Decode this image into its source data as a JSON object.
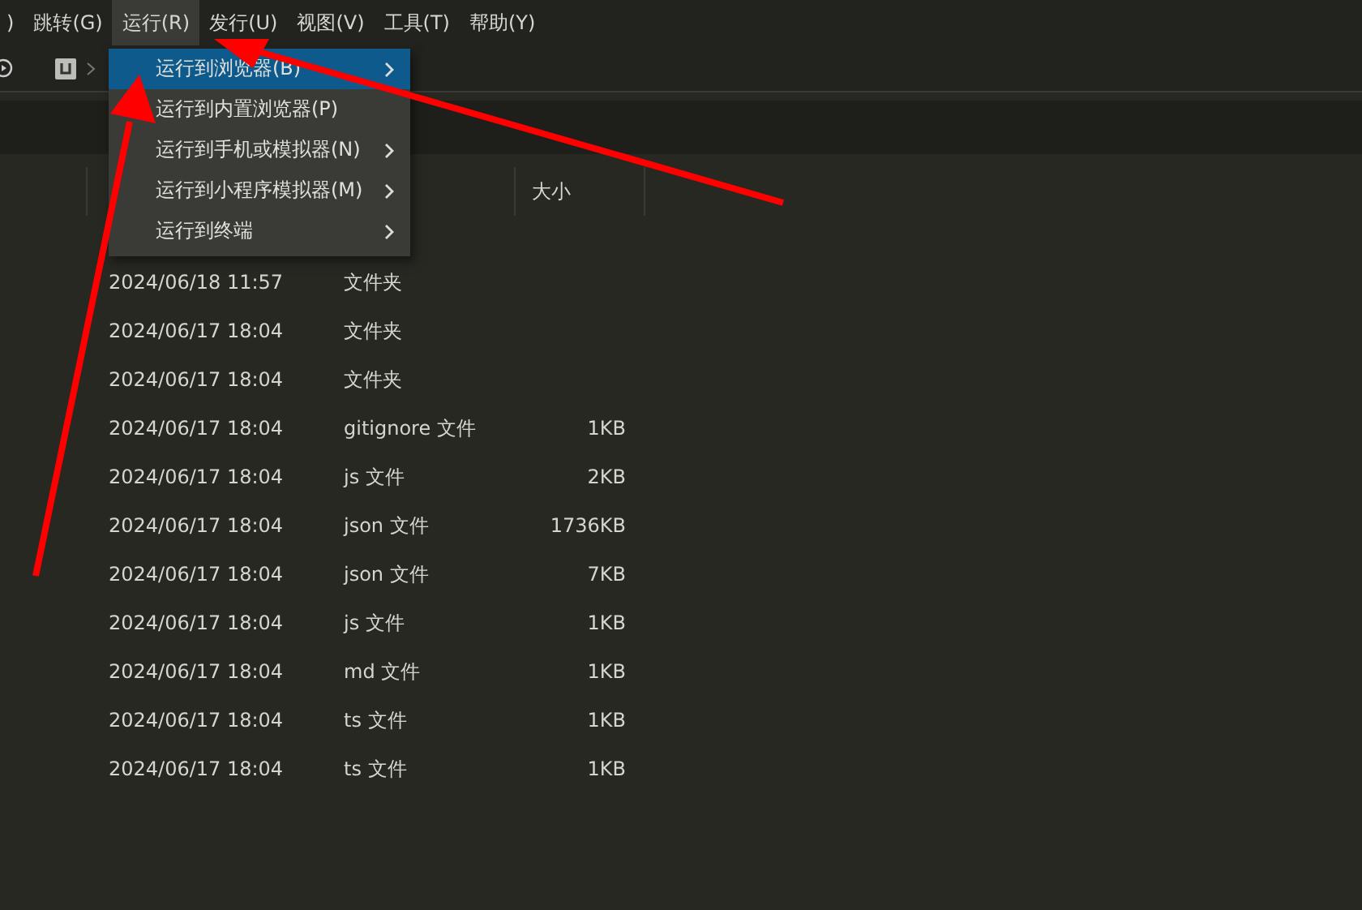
{
  "menu_bar": [
    {
      "label": ")",
      "selected": false
    },
    {
      "label": "跳转(G)",
      "selected": false
    },
    {
      "label": "运行(R)",
      "selected": true
    },
    {
      "label": "发行(U)",
      "selected": false
    },
    {
      "label": "视图(V)",
      "selected": false
    },
    {
      "label": "工具(T)",
      "selected": false
    },
    {
      "label": "帮助(Y)",
      "selected": false
    }
  ],
  "run_menu": [
    {
      "label": "运行到浏览器(B)",
      "selected": true,
      "submenu": true
    },
    {
      "label": "运行到内置浏览器(P)",
      "selected": false,
      "submenu": false
    },
    {
      "label": "运行到手机或模拟器(N)",
      "selected": false,
      "submenu": true
    },
    {
      "label": "运行到小程序模拟器(M)",
      "selected": false,
      "submenu": true
    },
    {
      "label": "运行到终端",
      "selected": false,
      "submenu": true
    }
  ],
  "table": {
    "size_header": "大小",
    "rows": [
      {
        "modified": "2024/06/18 11:57",
        "type": "文件夹"
      },
      {
        "modified": "2024/06/17 18:04",
        "type": "文件夹"
      },
      {
        "modified": "2024/06/17 18:04",
        "type": "文件夹"
      },
      {
        "modified": "2024/06/17 18:04",
        "type": "gitignore 文件",
        "size": "1KB"
      },
      {
        "modified": "2024/06/17 18:04",
        "type": "js 文件",
        "size": "2KB"
      },
      {
        "modified": "2024/06/17 18:04",
        "type": "json 文件",
        "size": "1736KB"
      },
      {
        "modified": "2024/06/17 18:04",
        "type": "json 文件",
        "size": "7KB"
      },
      {
        "modified": "2024/06/17 18:04",
        "type": "js 文件",
        "size": "1KB"
      },
      {
        "modified": "2024/06/17 18:04",
        "type": "md 文件",
        "size": "1KB"
      },
      {
        "modified": "2024/06/17 18:04",
        "type": "ts 文件",
        "size": "1KB"
      },
      {
        "modified": "2024/06/17 18:04",
        "type": "ts 文件",
        "size": "1KB"
      }
    ]
  }
}
